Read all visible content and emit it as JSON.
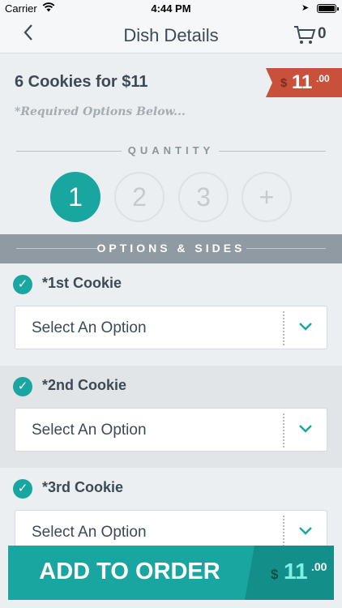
{
  "status_bar": {
    "carrier": "Carrier",
    "time": "4:44 PM"
  },
  "nav": {
    "title": "Dish Details",
    "cart_count": "0"
  },
  "dish": {
    "title": "6 Cookies for $11",
    "price_currency": "$",
    "price_dollars": "11",
    "price_cents": ".00",
    "required_note": "*Required Options Below..."
  },
  "quantity": {
    "label": "QUANTITY",
    "options": [
      "1",
      "2",
      "3",
      "+"
    ],
    "selected": "1"
  },
  "options_section": {
    "label": "OPTIONS & SIDES"
  },
  "option_groups": [
    {
      "name": "*1st Cookie",
      "placeholder": "Select An Option"
    },
    {
      "name": "*2nd Cookie",
      "placeholder": "Select An Option"
    },
    {
      "name": "*3rd Cookie",
      "placeholder": "Select An Option"
    }
  ],
  "add_to_order": {
    "label": "ADD TO ORDER",
    "price_currency": "$",
    "price_dollars": "11",
    "price_cents": ".00"
  },
  "colors": {
    "accent": "#1aa6a0",
    "price_tag": "#c9513b",
    "section_band": "#8f9aa2",
    "text": "#3d4a55"
  }
}
